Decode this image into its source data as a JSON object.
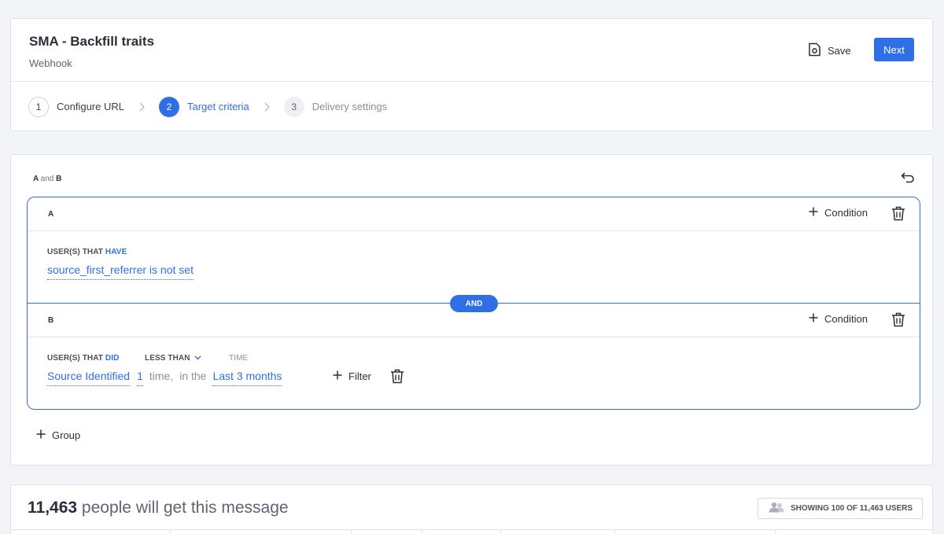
{
  "header": {
    "title": "SMA - Backfill traits",
    "subtitle": "Webhook",
    "save_label": "Save",
    "next_label": "Next",
    "accent_color": "#2f6fe5"
  },
  "steps": [
    {
      "num": "1",
      "label": "Configure URL",
      "state": "done"
    },
    {
      "num": "2",
      "label": "Target criteria",
      "state": "active"
    },
    {
      "num": "3",
      "label": "Delivery settings",
      "state": "todo"
    }
  ],
  "criteria": {
    "label_a": "A",
    "label_and": "and",
    "label_b": "B",
    "group_a": {
      "letter": "A",
      "condition_label": "Condition",
      "users_prefix": "USER(S) THAT",
      "users_verb": "HAVE",
      "rule": "source_first_referrer is not set"
    },
    "and_pill": "AND",
    "group_b": {
      "letter": "B",
      "condition_label": "Condition",
      "users_prefix": "USER(S) THAT",
      "users_verb": "DID",
      "frequency_label": "LESS THAN",
      "time_label": "TIME",
      "event": "Source Identified",
      "count": "1",
      "time_word": "time,",
      "in_the": "in the",
      "period": "Last 3 months",
      "filter_label": "Filter"
    },
    "add_group_label": "Group"
  },
  "people": {
    "count": "11,463",
    "suffix": "people will get this message",
    "showing": "SHOWING 100 OF 11,463 USERS"
  }
}
